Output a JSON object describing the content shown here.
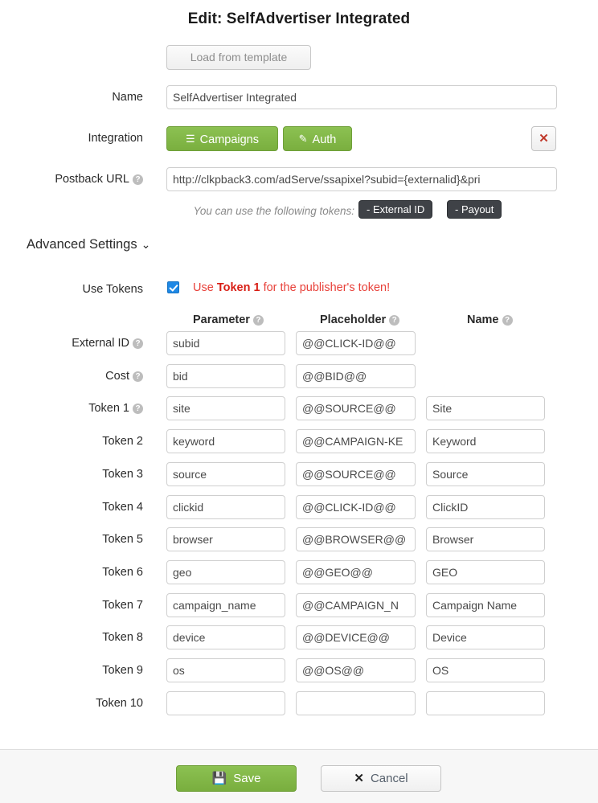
{
  "title": "Edit: SelfAdvertiser Integrated",
  "load_template": {
    "label": "Load from template"
  },
  "fields": {
    "name": {
      "label": "Name",
      "value": "SelfAdvertiser Integrated"
    },
    "integration": {
      "label": "Integration",
      "campaigns_label": "Campaigns",
      "auth_label": "Auth",
      "delete_label": "✕"
    },
    "postback": {
      "label": "Postback URL",
      "value": "http://clkpback3.com/adServe/ssapixel?subid={externalid}&pri"
    }
  },
  "tokens_hint": {
    "text": "You can use the following tokens:",
    "chips": [
      "- External ID",
      "- Payout"
    ]
  },
  "advanced_settings": {
    "label": "Advanced Settings",
    "chevron": "⌄"
  },
  "use_tokens": {
    "label": "Use Tokens",
    "checked": true,
    "message_prefix": "Use ",
    "message_bold": "Token 1",
    "message_suffix": " for the publisher's token!"
  },
  "columns": {
    "parameter": "Parameter",
    "placeholder": "Placeholder",
    "name": "Name",
    "help": "?"
  },
  "rows": [
    {
      "label": "External ID",
      "help": true,
      "parameter": "subid",
      "placeholder": "@@CLICK-ID@@",
      "name": null
    },
    {
      "label": "Cost",
      "help": true,
      "parameter": "bid",
      "placeholder": "@@BID@@",
      "name": null
    },
    {
      "label": "Token 1",
      "help": true,
      "parameter": "site",
      "placeholder": "@@SOURCE@@",
      "name": "Site"
    },
    {
      "label": "Token 2",
      "help": false,
      "parameter": "keyword",
      "placeholder": "@@CAMPAIGN-KE",
      "name": "Keyword"
    },
    {
      "label": "Token 3",
      "help": false,
      "parameter": "source",
      "placeholder": "@@SOURCE@@",
      "name": "Source"
    },
    {
      "label": "Token 4",
      "help": false,
      "parameter": "clickid",
      "placeholder": "@@CLICK-ID@@",
      "name": "ClickID"
    },
    {
      "label": "Token 5",
      "help": false,
      "parameter": "browser",
      "placeholder": "@@BROWSER@@",
      "name": "Browser"
    },
    {
      "label": "Token 6",
      "help": false,
      "parameter": "geo",
      "placeholder": "@@GEO@@",
      "name": "GEO"
    },
    {
      "label": "Token 7",
      "help": false,
      "parameter": "campaign_name",
      "placeholder": "@@CAMPAIGN_N",
      "name": "Campaign Name"
    },
    {
      "label": "Token 8",
      "help": false,
      "parameter": "device",
      "placeholder": "@@DEVICE@@",
      "name": "Device"
    },
    {
      "label": "Token 9",
      "help": false,
      "parameter": "os",
      "placeholder": "@@OS@@",
      "name": "OS"
    },
    {
      "label": "Token 10",
      "help": false,
      "parameter": "",
      "placeholder": "",
      "name": ""
    }
  ],
  "footer": {
    "save_label": "Save",
    "save_icon": "💾",
    "cancel_label": "Cancel",
    "cancel_icon": "✕"
  },
  "colors": {
    "green": "#7aaf3f",
    "red": "#c0392b",
    "alert_red": "#e8413a",
    "checkbox_blue": "#1e88e5",
    "chip_dark": "#3f4247"
  }
}
